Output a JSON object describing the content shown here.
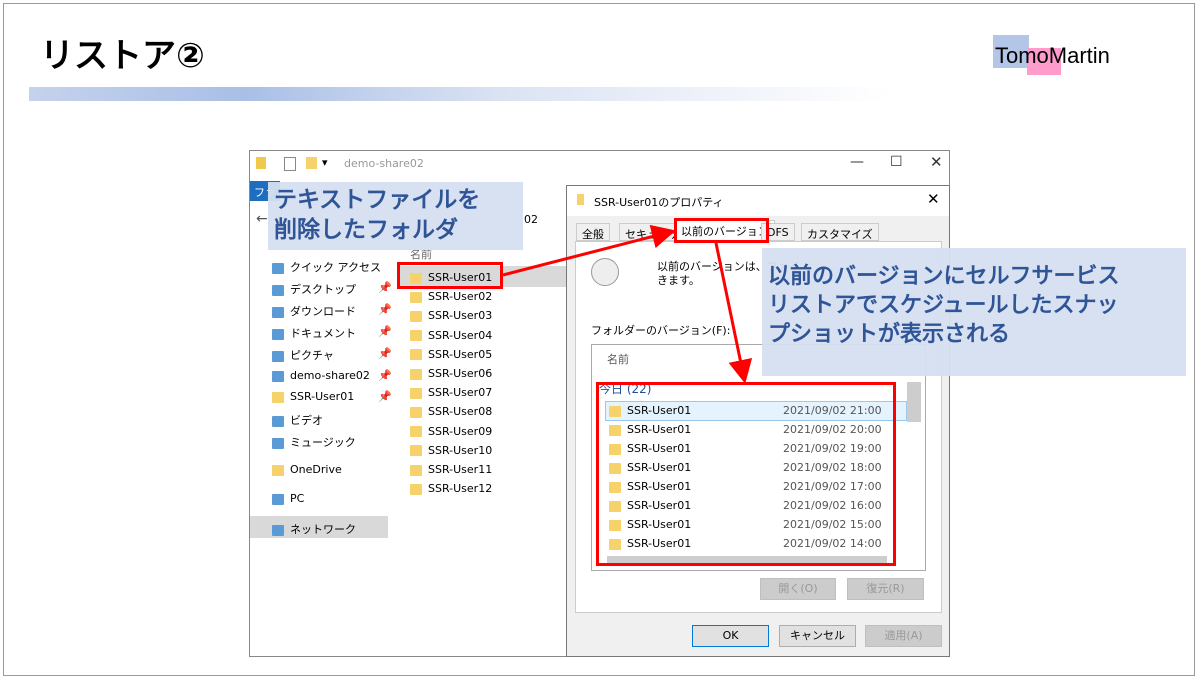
{
  "slide": {
    "title": "リストア②",
    "logo_part1": "Tomo",
    "logo_part2": "Martin"
  },
  "explorer": {
    "title": "demo-share02",
    "ribbon_tab": "ファ",
    "address_suffix": "02",
    "column_name": "名前",
    "nav": [
      {
        "label": "クイック アクセス",
        "icon": "star-icon"
      },
      {
        "label": "デスクトップ",
        "icon": "desktop-icon",
        "pinned": true
      },
      {
        "label": "ダウンロード",
        "icon": "download-icon",
        "pinned": true
      },
      {
        "label": "ドキュメント",
        "icon": "document-icon",
        "pinned": true
      },
      {
        "label": "ピクチャ",
        "icon": "picture-icon",
        "pinned": true
      },
      {
        "label": "demo-share02",
        "icon": "network-drive-icon",
        "pinned": true
      },
      {
        "label": "SSR-User01",
        "icon": "folder-icon",
        "pinned": true
      },
      {
        "label": "ビデオ",
        "icon": "video-icon"
      },
      {
        "label": "ミュージック",
        "icon": "music-icon"
      },
      {
        "label": "OneDrive",
        "icon": "folder-icon"
      },
      {
        "label": "PC",
        "icon": "pc-icon"
      },
      {
        "label": "ネットワーク",
        "icon": "network-icon",
        "selected": true
      }
    ],
    "folders": [
      "SSR-User01",
      "SSR-User02",
      "SSR-User03",
      "SSR-User04",
      "SSR-User05",
      "SSR-User06",
      "SSR-User07",
      "SSR-User08",
      "SSR-User09",
      "SSR-User10",
      "SSR-User11",
      "SSR-User12"
    ]
  },
  "dialog": {
    "title": "SSR-User01のプロパティ",
    "tabs": [
      "全般",
      "セキュリティ",
      "以前のバージョン",
      "DFS",
      "カスタマイズ"
    ],
    "active_tab": "以前のバージョン",
    "description_line1": "以前のバージョンは、ファイ",
    "description_line2": "きます。",
    "list_label": "フォルダーのバージョン(F):",
    "column_name": "名前",
    "group": "今日 (22)",
    "versions": [
      {
        "name": "SSR-User01",
        "date": "2021/09/02 21:00"
      },
      {
        "name": "SSR-User01",
        "date": "2021/09/02 20:00"
      },
      {
        "name": "SSR-User01",
        "date": "2021/09/02 19:00"
      },
      {
        "name": "SSR-User01",
        "date": "2021/09/02 18:00"
      },
      {
        "name": "SSR-User01",
        "date": "2021/09/02 17:00"
      },
      {
        "name": "SSR-User01",
        "date": "2021/09/02 16:00"
      },
      {
        "name": "SSR-User01",
        "date": "2021/09/02 15:00"
      },
      {
        "name": "SSR-User01",
        "date": "2021/09/02 14:00"
      }
    ],
    "open_button": "開く(O)",
    "restore_button": "復元(R)",
    "ok_button": "OK",
    "cancel_button": "キャンセル",
    "apply_button": "適用(A)"
  },
  "callouts": {
    "left_line1": "テキストファイルを",
    "left_line2": "削除したフォルダ",
    "right_line1": "以前のバージョンにセルフサービス",
    "right_line2": "リストアでスケジュールしたスナッ",
    "right_line3": "プショットが表示される"
  },
  "colors": {
    "highlight": "#ff0000",
    "callout_bg": "#d6dff0",
    "callout_text": "#2f5597"
  }
}
